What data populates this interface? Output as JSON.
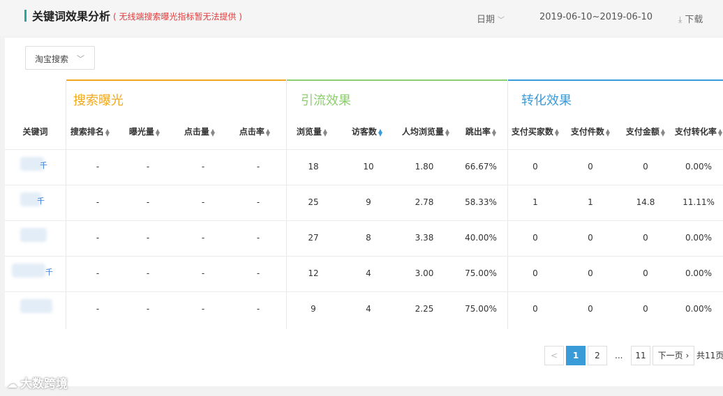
{
  "header": {
    "title": "关键词效果分析",
    "note": "( 无线端搜索曝光指标暂无法提供 )",
    "date_label": "日期",
    "date_range": "2019-06-10~2019-06-10",
    "download_label": "下载"
  },
  "filter": {
    "selected": "淘宝搜索"
  },
  "groups": [
    {
      "title": "搜索曝光",
      "color": "#f0a81d"
    },
    {
      "title": "引流效果",
      "color": "#8ccf6e"
    },
    {
      "title": "转化效果",
      "color": "#3a9bd9"
    }
  ],
  "columns": [
    "关键词",
    "搜索排名",
    "曝光量",
    "点击量",
    "点击率",
    "浏览量",
    "访客数",
    "人均浏览量",
    "跳出率",
    "支付买家数",
    "支付件数",
    "支付金额",
    "支付转化率"
  ],
  "rows": [
    {
      "keyword": "千",
      "values": [
        "-",
        "-",
        "-",
        "-",
        "18",
        "10",
        "1.80",
        "66.67%",
        "0",
        "0",
        "0",
        "0.00%"
      ]
    },
    {
      "keyword": "千",
      "values": [
        "-",
        "-",
        "-",
        "-",
        "25",
        "9",
        "2.78",
        "58.33%",
        "1",
        "1",
        "14.8",
        "11.11%"
      ]
    },
    {
      "keyword": "",
      "values": [
        "-",
        "-",
        "-",
        "-",
        "27",
        "8",
        "3.38",
        "40.00%",
        "0",
        "0",
        "0",
        "0.00%"
      ]
    },
    {
      "keyword": "千",
      "values": [
        "-",
        "-",
        "-",
        "-",
        "12",
        "4",
        "3.00",
        "75.00%",
        "0",
        "0",
        "0",
        "0.00%"
      ]
    },
    {
      "keyword": "",
      "values": [
        "-",
        "-",
        "-",
        "-",
        "9",
        "4",
        "2.25",
        "75.00%",
        "0",
        "0",
        "0",
        "0.00%"
      ]
    }
  ],
  "pagination": {
    "prev": "<",
    "pages": [
      "1",
      "2"
    ],
    "ellipsis": "...",
    "last": "11",
    "next": "下一页",
    "total": "共11页",
    "current": "1"
  },
  "watermark": "大数跨境",
  "colors": {
    "accent": "#3a9bd9",
    "title_bar": "#2aa6a1",
    "note": "#e23b3b"
  }
}
